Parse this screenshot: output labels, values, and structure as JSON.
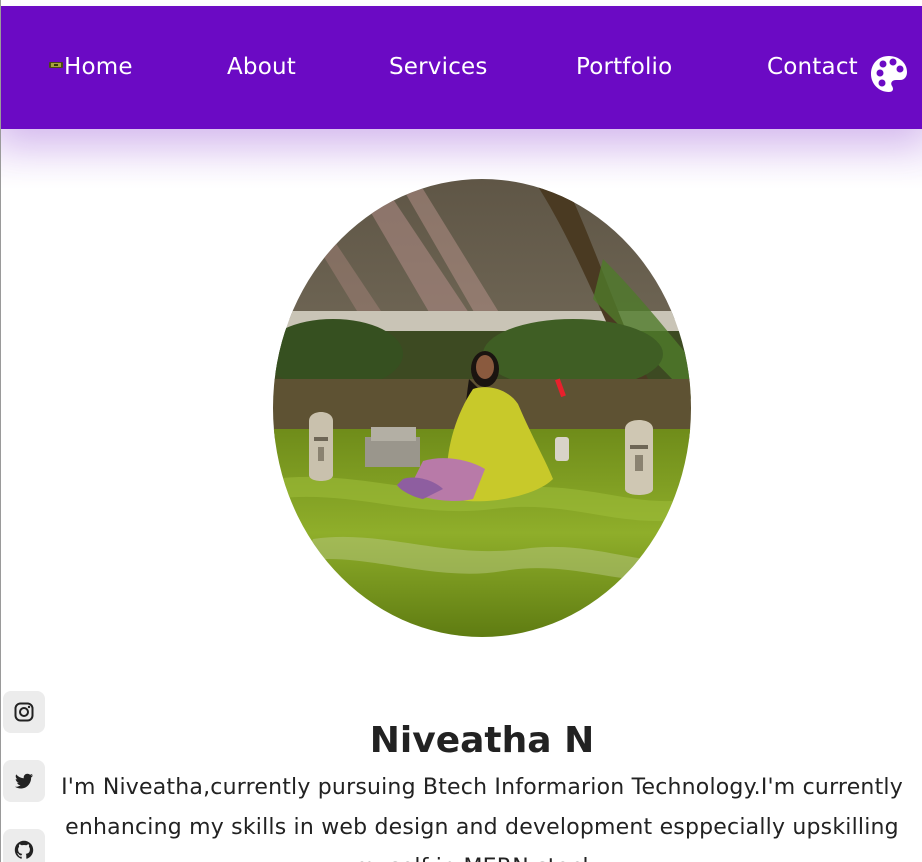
{
  "nav": {
    "items": [
      {
        "label": "Home"
      },
      {
        "label": "About"
      },
      {
        "label": "Services"
      },
      {
        "label": "Portfolio"
      },
      {
        "label": "Contact"
      }
    ],
    "icons": {
      "home": "home-icon",
      "theme": "palette-icon"
    }
  },
  "profile": {
    "name": "Niveatha N",
    "bio": "I'm Niveatha,currently pursuing Btech Informarion Technology.I'm currently enhancing my skills in web design and development esppecially upskilling myself in MERN stack ."
  },
  "social": [
    {
      "icon": "instagram-icon"
    },
    {
      "icon": "twitter-icon"
    },
    {
      "icon": "github-icon"
    }
  ],
  "colors": {
    "nav_background": "#6b0ac4",
    "text": "#222222",
    "social_background": "#ececec"
  }
}
